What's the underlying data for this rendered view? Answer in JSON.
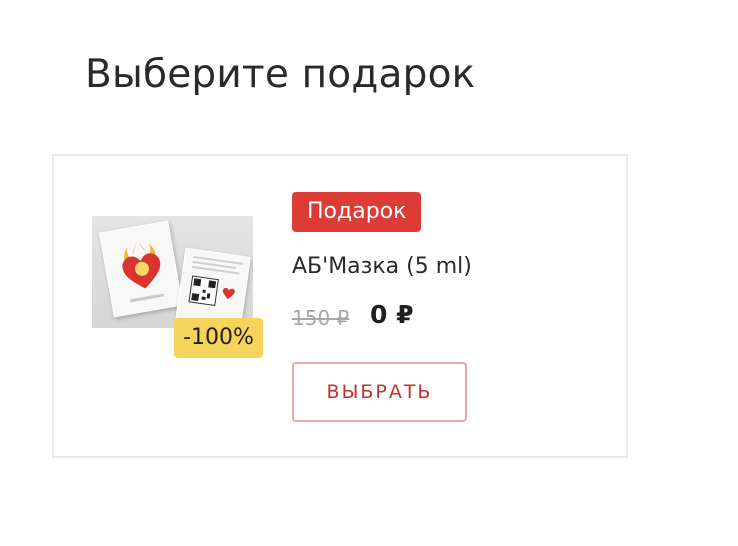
{
  "page": {
    "title": "Выберите подарок"
  },
  "gift": {
    "badge_label": "Подарок",
    "product_name": "АБ'Мазка (5 ml)",
    "price_old": "150 ₽",
    "price_new": "0 ₽",
    "discount_label": "-100%",
    "select_button_label": "ВЫБРАТЬ",
    "product_image_icon": "product-sachet-image"
  },
  "colors": {
    "badge_bg": "#dc3b36",
    "discount_bg": "#f6d45b",
    "button_border": "#e9a8a6",
    "button_text": "#c7302c"
  }
}
